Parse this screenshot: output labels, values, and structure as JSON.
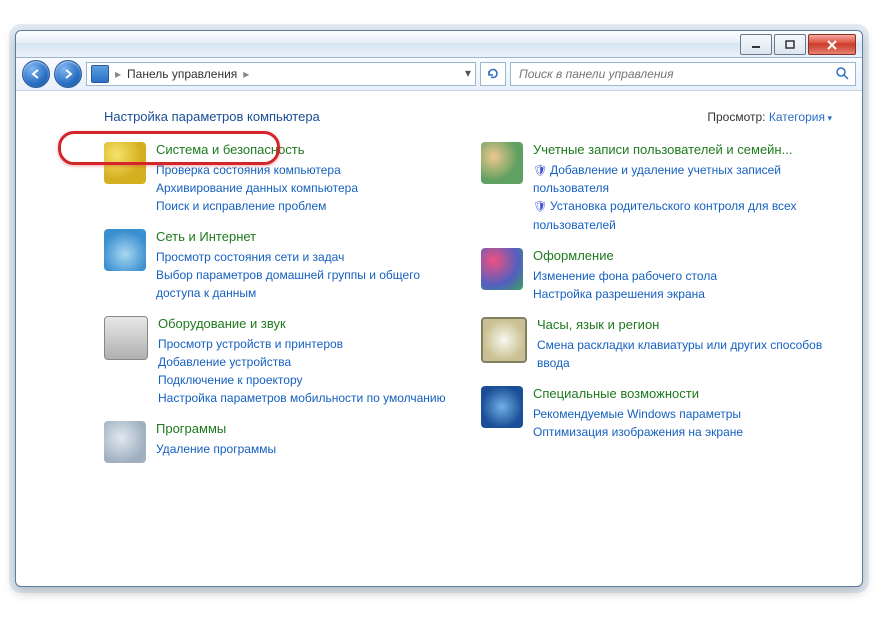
{
  "titlebar": {
    "min_label": "minimize",
    "max_label": "maximize",
    "close_label": "close"
  },
  "breadcrumb": {
    "root": "Панель управления"
  },
  "search": {
    "placeholder": "Поиск в панели управления"
  },
  "header": {
    "title": "Настройка параметров компьютера",
    "view_label": "Просмотр:",
    "view_value": "Категория"
  },
  "left": [
    {
      "title": "Система и безопасность",
      "subs": [
        {
          "label": "Проверка состояния компьютера"
        },
        {
          "label": "Архивирование данных компьютера"
        },
        {
          "label": "Поиск и исправление проблем"
        }
      ]
    },
    {
      "title": "Сеть и Интернет",
      "subs": [
        {
          "label": "Просмотр состояния сети и задач"
        },
        {
          "label": "Выбор параметров домашней группы и общего доступа к данным"
        }
      ]
    },
    {
      "title": "Оборудование и звук",
      "subs": [
        {
          "label": "Просмотр устройств и принтеров"
        },
        {
          "label": "Добавление устройства"
        },
        {
          "label": "Подключение к проектору"
        },
        {
          "label": "Настройка параметров мобильности по умолчанию"
        }
      ]
    },
    {
      "title": "Программы",
      "subs": [
        {
          "label": "Удаление программы"
        }
      ]
    }
  ],
  "right": [
    {
      "title": "Учетные записи пользователей и семейн...",
      "subs": [
        {
          "label": "Добавление и удаление учетных записей пользователя",
          "shield": true
        },
        {
          "label": "Установка родительского контроля для всех пользователей",
          "shield": true
        }
      ]
    },
    {
      "title": "Оформление",
      "subs": [
        {
          "label": "Изменение фона рабочего стола"
        },
        {
          "label": "Настройка разрешения экрана"
        }
      ]
    },
    {
      "title": "Часы, язык и регион",
      "subs": [
        {
          "label": "Смена раскладки клавиатуры или других способов ввода"
        }
      ]
    },
    {
      "title": "Специальные возможности",
      "subs": [
        {
          "label": "Рекомендуемые Windows параметры"
        },
        {
          "label": "Оптимизация изображения на экране"
        }
      ]
    }
  ]
}
